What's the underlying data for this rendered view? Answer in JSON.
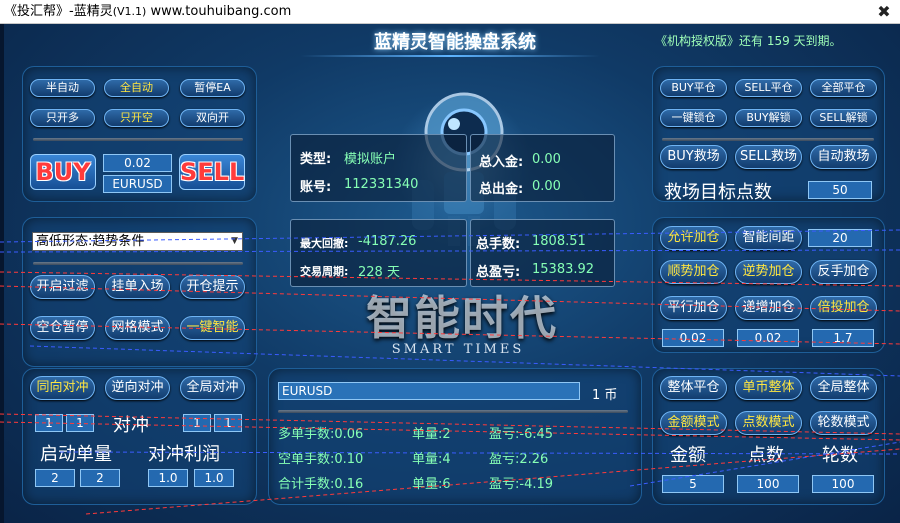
{
  "window": {
    "title": "《投汇帮》-蓝精灵",
    "version": "(V1.1)",
    "url": "www.touhuibang.com",
    "close": "✖"
  },
  "header": {
    "title": "蓝精灵智能操盘系统",
    "authorization": "《机构授权版》还有 159 天到期。"
  },
  "left_top": {
    "row1": [
      "半自动",
      "全自动",
      "暂停EA"
    ],
    "row2": [
      "只开多",
      "只开空",
      "双向开"
    ],
    "buy_label": "BUY",
    "sell_label": "SELL",
    "lot": "0.02",
    "symbol": "EURUSD"
  },
  "left_mid": {
    "select_value": "高低形态:趋势条件",
    "row1": [
      "开启过滤",
      "挂单入场",
      "开仓提示"
    ],
    "row2": [
      "空仓暂停",
      "网格模式",
      "一键智能"
    ]
  },
  "left_bottom": {
    "row1": [
      "同向对冲",
      "逆向对冲",
      "全局对冲"
    ],
    "hedge_label": "对冲",
    "hedge_left": [
      "1",
      "1"
    ],
    "hedge_right": [
      "1",
      "1"
    ],
    "start_lot_label": "启动单量",
    "hedge_profit_label": "对冲利润",
    "start_lot_values": [
      "2",
      "2"
    ],
    "hedge_profit_values": [
      "1.0",
      "1.0"
    ]
  },
  "account": {
    "type_label": "类型:",
    "type_value": "模拟账户",
    "account_label": "账号:",
    "account_value": "112331340",
    "deposit_label": "总入金:",
    "deposit_value": "0.00",
    "withdraw_label": "总出金:",
    "withdraw_value": "0.00",
    "max_dd_label": "最大回撤:",
    "max_dd_value": "-4187.26",
    "cycle_label": "交易周期:",
    "cycle_value": "228 天",
    "total_lots_label": "总手数:",
    "total_lots_value": "1808.51",
    "total_profit_label": "总盈亏:",
    "total_profit_value": "15383.92"
  },
  "slogan": {
    "main": "智能时代",
    "sub": "SMART TIMES"
  },
  "positions": {
    "symbol": "EURUSD",
    "symbol_count": "1 币",
    "rows": [
      {
        "label": "多单手数:0.06",
        "count": "单量:2",
        "profit": "盈亏:-6.45"
      },
      {
        "label": "空单手数:0.10",
        "count": "单量:4",
        "profit": "盈亏:2.26"
      },
      {
        "label": "合计手数:0.16",
        "count": "单量:6",
        "profit": "盈亏:-4.19"
      }
    ]
  },
  "right_top": {
    "row1": [
      "BUY平仓",
      "SELL平仓",
      "全部平仓"
    ],
    "row2": [
      "一键锁仓",
      "BUY解锁",
      "SELL解锁"
    ],
    "row3": [
      "BUY救场",
      "SELL救场",
      "自动救场"
    ],
    "rescue_label": "救场目标点数",
    "rescue_value": "50"
  },
  "right_mid": {
    "row1": [
      "允许加仓",
      "智能间距"
    ],
    "row1_value": "20",
    "row2": [
      "顺势加仓",
      "逆势加仓",
      "反手加仓"
    ],
    "row3": [
      "平行加仓",
      "递增加仓",
      "倍投加仓"
    ],
    "values": [
      "0.02",
      "0.02",
      "1.7"
    ]
  },
  "right_bottom": {
    "row1": [
      "整体平仓",
      "单币整体",
      "全局整体"
    ],
    "row2": [
      "金额模式",
      "点数模式",
      "轮数模式"
    ],
    "labels": [
      "金额",
      "点数",
      "轮数"
    ],
    "values": [
      "5",
      "100",
      "100"
    ]
  },
  "colors": {
    "background": "#103a66",
    "accent_yellow": "#ffe640",
    "value_green": "#86ffb5",
    "buy_sell_red": "#ff3b3b"
  }
}
